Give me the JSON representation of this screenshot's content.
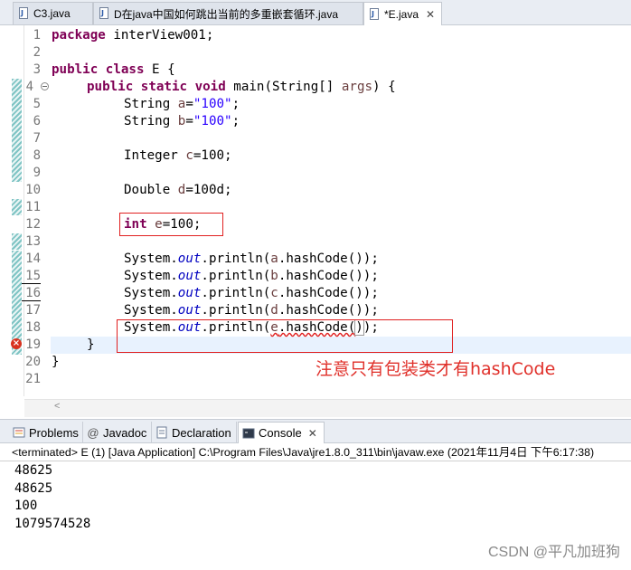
{
  "editor_tabs": [
    {
      "label": "C3.java",
      "active": false
    },
    {
      "label": "D在java中国如何跳出当前的多重嵌套循环.java",
      "active": false
    },
    {
      "label": "*E.java",
      "active": true,
      "close": "✕"
    }
  ],
  "code_lines": [
    {
      "no": "1"
    },
    {
      "no": "2"
    },
    {
      "no": "3"
    },
    {
      "no": "4"
    },
    {
      "no": "5"
    },
    {
      "no": "6"
    },
    {
      "no": "7"
    },
    {
      "no": "8"
    },
    {
      "no": "9"
    },
    {
      "no": "10"
    },
    {
      "no": "11"
    },
    {
      "no": "12"
    },
    {
      "no": "13"
    },
    {
      "no": "14"
    },
    {
      "no": "15"
    },
    {
      "no": "16"
    },
    {
      "no": "17"
    },
    {
      "no": "18"
    },
    {
      "no": "19"
    },
    {
      "no": "20"
    },
    {
      "no": "21"
    }
  ],
  "code": {
    "l1_kw": "package",
    "l1_rest": " interView001;",
    "l3_kw": "public class",
    "l3_rest": " E {",
    "l4_kw1": "public static void",
    "l4_rest1": " main(String[] ",
    "l4_var": "args",
    "l4_rest2": ") {",
    "l5_a": "String ",
    "l5_v": "a",
    "l5_b": "=",
    "l5_s": "\"100\"",
    "l5_c": ";",
    "l6_a": "String ",
    "l6_v": "b",
    "l6_b": "=",
    "l6_s": "\"100\"",
    "l6_c": ";",
    "l8_a": "Integer ",
    "l8_v": "c",
    "l8_b": "=100;",
    "l10_a": "Double ",
    "l10_v": "d",
    "l10_b": "=100d;",
    "l12_kw": "int",
    "l12_sp": " ",
    "l12_v": "e",
    "l12_b": "=100;",
    "print_a": "System.",
    "print_out": "out",
    "print_b": ".println(",
    "l14_v": "a",
    "l15_v": "b",
    "l16_v": "c",
    "l17_v": "d",
    "l18_v": "e",
    "print_c": ".hashCode());",
    "l18_c1": ".hashCode(",
    "l18_c2": ")",
    "l18_c3": ");",
    "l19": "}",
    "l20": "}"
  },
  "annotation": "注意只有包装类才有hashCode",
  "panel_tabs": [
    {
      "label": "Problems",
      "icon": "problems-icon"
    },
    {
      "label": "Javadoc",
      "icon": "javadoc-icon",
      "glyph": "@"
    },
    {
      "label": "Declaration",
      "icon": "declaration-icon"
    },
    {
      "label": "Console",
      "icon": "console-icon",
      "active": true,
      "close": "✕"
    }
  ],
  "console": {
    "header": "<terminated> E (1) [Java Application] C:\\Program Files\\Java\\jre1.8.0_311\\bin\\javaw.exe  (2021年11月4日 下午6:17:38)",
    "output": [
      "48625",
      "48625",
      "100",
      "1079574528"
    ]
  },
  "watermark": "CSDN @平凡加班狗",
  "colors": {
    "keyword": "#7f0055",
    "string": "#2a00ff",
    "field": "#0000c0",
    "annotation": "#e0302a"
  }
}
